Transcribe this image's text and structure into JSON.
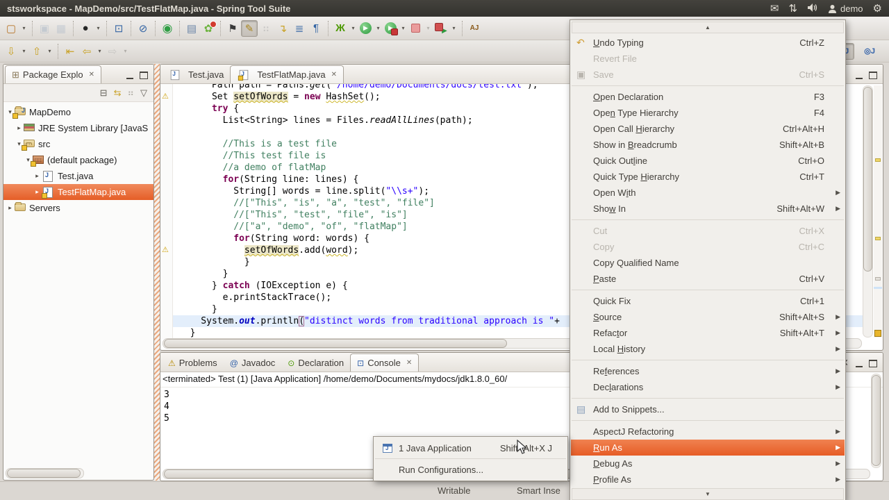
{
  "titlebar": {
    "title": "stsworkspace - MapDemo/src/TestFlatMap.java - Spring Tool Suite",
    "user": "demo"
  },
  "toolbar_row1": [
    {
      "n": "new-wizard",
      "g": "▢",
      "col": "#b8762a"
    },
    {
      "dd": 1
    },
    {
      "sep": 1
    },
    {
      "n": "save",
      "g": "▣",
      "col": "#8ba0ba",
      "dis": 1
    },
    {
      "n": "save-all",
      "g": "▦",
      "col": "#8ba0ba",
      "dis": 1
    },
    {
      "sep": 1
    },
    {
      "n": "user-profile",
      "g": "●",
      "col": "#262626"
    },
    {
      "dd": 1
    },
    {
      "sep": 1
    },
    {
      "n": "terminal",
      "g": "⊡",
      "col": "#3465a4"
    },
    {
      "sep": 1
    },
    {
      "n": "skip-breakpoints",
      "g": "⊘",
      "col": "#3465a4"
    },
    {
      "sep": 1
    },
    {
      "n": "boot-dashboard",
      "g": "◉",
      "col": "#2f9e44"
    },
    {
      "sep": 1
    },
    {
      "n": "new-note",
      "g": "▤",
      "col": "#6c86a8"
    },
    {
      "n": "spring-badge",
      "g": "✿",
      "col": "#6db33f"
    },
    {
      "sep": 1
    },
    {
      "n": "flashlight",
      "g": "⚑",
      "col": "#3a3a3a"
    },
    {
      "n": "highlighter",
      "g": "✎",
      "col": "#a8851f",
      "act": 1
    },
    {
      "n": "coverage-dots",
      "g": "⠶",
      "col": "#9a9a9a",
      "dis": 1
    },
    {
      "n": "note-arrow",
      "g": "↴",
      "col": "#c9a227"
    },
    {
      "n": "view-list",
      "g": "≣",
      "col": "#3465a4"
    },
    {
      "n": "show-whitespace",
      "g": "¶",
      "col": "#3465a4"
    },
    {
      "sep": 1
    },
    {
      "n": "debug",
      "g": "Ж",
      "col": "#4e9a06"
    },
    {
      "dd": 1
    },
    {
      "n": "run",
      "g": "▶",
      "col": "#ffffff"
    },
    {
      "dd": 1
    },
    {
      "n": "run-badge",
      "g": "▶",
      "col": "#ffffff"
    },
    {
      "dd": 1
    },
    {
      "n": "stop",
      "g": "",
      "col": ""
    },
    {
      "dd": 1,
      "dis": 1
    },
    {
      "n": "relaunch",
      "g": "▶",
      "col": "#2e9b3f"
    },
    {
      "dd": 1
    },
    {
      "sep": 1
    },
    {
      "n": "aspectj",
      "g": "AJ",
      "col": "#8a5a1a"
    }
  ],
  "toolbar_row2": [
    {
      "n": "next-annotation",
      "g": "⇩",
      "col": "#c9a227"
    },
    {
      "dd": 1
    },
    {
      "n": "prev-annotation",
      "g": "⇧",
      "col": "#c9a227"
    },
    {
      "dd": 1
    },
    {
      "sep": 1
    },
    {
      "n": "last-edit-location",
      "g": "⇤",
      "col": "#c9a227"
    },
    {
      "n": "back",
      "g": "⇦",
      "col": "#c9a227"
    },
    {
      "dd": 1
    },
    {
      "n": "forward",
      "g": "⇨",
      "col": "#999999",
      "dis": 1
    },
    {
      "dd": 1,
      "dis": 1
    }
  ],
  "perspectives": [
    {
      "n": "java-perspective",
      "g": "⊞J",
      "act": 1
    },
    {
      "n": "java-browsing-perspective",
      "g": "◎J",
      "act": 0
    }
  ],
  "package_explorer": {
    "tab": "Package Explo",
    "toolbar": [
      {
        "n": "collapse-all",
        "g": "⊟"
      },
      {
        "n": "link-with-editor",
        "g": "⇆",
        "col": "#c9a227"
      },
      {
        "n": "focus",
        "g": "⠶",
        "col": "#b0aca4"
      },
      {
        "n": "view-menu",
        "g": "▽"
      }
    ],
    "tree": [
      {
        "label": "MapDemo",
        "depth": 0,
        "arrow": "▾",
        "icon": "project",
        "warn": true
      },
      {
        "label": "JRE System Library [JavaS",
        "depth": 1,
        "arrow": "▸",
        "icon": "library"
      },
      {
        "label": "src",
        "depth": 1,
        "arrow": "▾",
        "icon": "srcfolder",
        "warn": true
      },
      {
        "label": "(default package)",
        "depth": 2,
        "arrow": "▾",
        "icon": "package",
        "warn": true
      },
      {
        "label": "Test.java",
        "depth": 3,
        "arrow": "▸",
        "icon": "jclass"
      },
      {
        "label": "TestFlatMap.java",
        "depth": 3,
        "arrow": "▸",
        "icon": "jclass",
        "warn": true,
        "selected": true
      },
      {
        "label": "Servers",
        "depth": 0,
        "arrow": "▸",
        "icon": "folder"
      }
    ]
  },
  "editor": {
    "tabs": [
      {
        "label": "Test.java",
        "active": false,
        "warn": false
      },
      {
        "label": "TestFlatMap.java",
        "active": true,
        "warn": true
      }
    ],
    "warn_lines": [
      1,
      14
    ],
    "code": [
      {
        "seg": [
          [
            "d",
            "      Path path = Paths."
          ],
          [
            "m",
            "get"
          ],
          [
            "d",
            "("
          ],
          [
            "s",
            "\"/home/demo/Documents/docs/test.txt\""
          ],
          [
            "d",
            ");"
          ]
        ]
      },
      {
        "seg": [
          [
            "d",
            "      Set "
          ],
          [
            "occ",
            "setOfWords"
          ],
          [
            "d",
            " = "
          ],
          [
            "k",
            "new"
          ],
          [
            "d",
            " "
          ],
          [
            "w",
            "HashSet"
          ],
          [
            "d",
            "();"
          ]
        ]
      },
      {
        "seg": [
          [
            "d",
            "      "
          ],
          [
            "k",
            "try"
          ],
          [
            "d",
            " {"
          ]
        ]
      },
      {
        "seg": [
          [
            "d",
            "        List<String> lines = Files."
          ],
          [
            "m",
            "readAllLines"
          ],
          [
            "d",
            "(path);"
          ]
        ]
      },
      {
        "seg": []
      },
      {
        "seg": [
          [
            "d",
            "        "
          ],
          [
            "c",
            "//This is a test file"
          ]
        ]
      },
      {
        "seg": [
          [
            "d",
            "        "
          ],
          [
            "c",
            "//This test file is"
          ]
        ]
      },
      {
        "seg": [
          [
            "d",
            "        "
          ],
          [
            "c",
            "//a demo of flatMap"
          ]
        ]
      },
      {
        "seg": [
          [
            "d",
            "        "
          ],
          [
            "k",
            "for"
          ],
          [
            "d",
            "(String line: lines) {"
          ]
        ]
      },
      {
        "seg": [
          [
            "d",
            "          String[] words = line.split("
          ],
          [
            "s",
            "\"\\\\s+\""
          ],
          [
            "d",
            ");"
          ]
        ]
      },
      {
        "seg": [
          [
            "d",
            "          "
          ],
          [
            "c",
            "//[\"This\", \"is\", \"a\", \"test\", \"file\"]"
          ]
        ]
      },
      {
        "seg": [
          [
            "d",
            "          "
          ],
          [
            "c",
            "//[\"This\", \"test\", \"file\", \"is\"]"
          ]
        ]
      },
      {
        "seg": [
          [
            "d",
            "          "
          ],
          [
            "c",
            "//[\"a\", \"demo\", \"of\", \"flatMap\"]"
          ]
        ]
      },
      {
        "seg": [
          [
            "d",
            "          "
          ],
          [
            "k",
            "for"
          ],
          [
            "d",
            "(String word: words) {"
          ]
        ]
      },
      {
        "seg": [
          [
            "d",
            "            "
          ],
          [
            "occ",
            "setOfWords"
          ],
          [
            "d",
            ".add("
          ],
          [
            "w",
            "word"
          ],
          [
            "d",
            ");"
          ]
        ]
      },
      {
        "seg": [
          [
            "d",
            "            }"
          ]
        ]
      },
      {
        "seg": [
          [
            "d",
            "        }"
          ]
        ]
      },
      {
        "seg": [
          [
            "d",
            "      } "
          ],
          [
            "k",
            "catch"
          ],
          [
            "d",
            " (IOException e) {"
          ]
        ]
      },
      {
        "seg": [
          [
            "d",
            "        e.printStackTrace();"
          ]
        ]
      },
      {
        "seg": [
          [
            "d",
            "      }"
          ]
        ]
      },
      {
        "seg": [
          [
            "d",
            "    System."
          ],
          [
            "f",
            "out"
          ],
          [
            "d",
            ".println"
          ],
          [
            "p",
            "("
          ],
          [
            "s",
            "\"distinct words from traditional approach is \""
          ],
          [
            "d",
            "+"
          ]
        ],
        "cur": true
      },
      {
        "seg": [
          [
            "d",
            "  }"
          ]
        ]
      }
    ]
  },
  "console": {
    "tabs": [
      {
        "label": "Problems",
        "icon": "problems",
        "g": "⚠",
        "col": "#b58900",
        "active": false
      },
      {
        "label": "Javadoc",
        "icon": "javadoc",
        "g": "@",
        "col": "#2f5fa8",
        "active": false
      },
      {
        "label": "Declaration",
        "icon": "declaration",
        "g": "⊙",
        "col": "#4e9a06",
        "active": false
      },
      {
        "label": "Console",
        "icon": "console",
        "g": "⊡",
        "col": "#2f5fa8",
        "active": true
      }
    ],
    "toolbar": [
      {
        "n": "refresh",
        "g": "↻",
        "col": "#c9a227",
        "dis": 1
      },
      {
        "n": "terminate",
        "g": "■",
        "col": "#e06666"
      },
      {
        "n": "close-console",
        "g": "✕",
        "col": "#55524c"
      }
    ],
    "status_line": "<terminated> Test (1) [Java Application] /home/demo/Documents/mydocs/jdk1.8.0_60/",
    "output": [
      "3",
      "4",
      "5"
    ]
  },
  "statusbar": {
    "writable": "Writable",
    "smart_insert": "Smart Inse"
  },
  "context_menu": {
    "items": [
      {
        "type": "scroll",
        "glyph": "▲"
      },
      {
        "label": "Undo Typing",
        "shortcut": "Ctrl+Z",
        "icon": "undo",
        "mn": 0
      },
      {
        "label": "Revert File",
        "disabled": true
      },
      {
        "label": "Save",
        "shortcut": "Ctrl+S",
        "icon": "save",
        "disabled": true
      },
      {
        "type": "sep"
      },
      {
        "label": "Open Declaration",
        "shortcut": "F3",
        "mn": 0
      },
      {
        "label": "Open Type Hierarchy",
        "shortcut": "F4",
        "mn": 3
      },
      {
        "label": "Open Call Hierarchy",
        "shortcut": "Ctrl+Alt+H",
        "mn": 10
      },
      {
        "label": "Show in Breadcrumb",
        "shortcut": "Shift+Alt+B",
        "mn": 8
      },
      {
        "label": "Quick Outline",
        "shortcut": "Ctrl+O",
        "mn": 9
      },
      {
        "label": "Quick Type Hierarchy",
        "shortcut": "Ctrl+T",
        "mn": 11
      },
      {
        "label": "Open With",
        "arrow": true,
        "mn": 6
      },
      {
        "label": "Show In",
        "shortcut": "Shift+Alt+W",
        "arrow": true,
        "mn": 3
      },
      {
        "type": "sep"
      },
      {
        "label": "Cut",
        "shortcut": "Ctrl+X",
        "disabled": true
      },
      {
        "label": "Copy",
        "shortcut": "Ctrl+C",
        "disabled": true
      },
      {
        "label": "Copy Qualified Name"
      },
      {
        "label": "Paste",
        "shortcut": "Ctrl+V",
        "mn": 0
      },
      {
        "type": "sep"
      },
      {
        "label": "Quick Fix",
        "shortcut": "Ctrl+1"
      },
      {
        "label": "Source",
        "shortcut": "Shift+Alt+S",
        "arrow": true,
        "mn": 0
      },
      {
        "label": "Refactor",
        "shortcut": "Shift+Alt+T",
        "arrow": true,
        "mn": 5
      },
      {
        "label": "Local History",
        "arrow": true,
        "mn": 6
      },
      {
        "type": "sep"
      },
      {
        "label": "References",
        "arrow": true,
        "mn": 2
      },
      {
        "label": "Declarations",
        "arrow": true,
        "mn": 3
      },
      {
        "type": "sep"
      },
      {
        "label": "Add to Snippets...",
        "icon": "snippets"
      },
      {
        "type": "sep"
      },
      {
        "label": "AspectJ Refactoring",
        "arrow": true
      },
      {
        "label": "Run As",
        "arrow": true,
        "highlight": true,
        "mn": 0
      },
      {
        "label": "Debug As",
        "arrow": true,
        "mn": 0
      },
      {
        "label": "Profile As",
        "arrow": true,
        "mn": 0
      },
      {
        "type": "scroll",
        "glyph": "▼"
      }
    ],
    "icon_glyphs": {
      "undo": {
        "g": "↶",
        "col": "#cf9b2f"
      },
      "save": {
        "g": "▣",
        "col": "#8ba0ba"
      },
      "snippets": {
        "g": "▤",
        "col": "#8ba0ba"
      }
    }
  },
  "submenu": {
    "items": [
      {
        "label": "1 Java Application",
        "shortcut": "Shift+Alt+X J",
        "icon": "java-app"
      },
      {
        "type": "sep"
      },
      {
        "label": "Run Configurations...",
        "shortcut": ""
      }
    ]
  }
}
